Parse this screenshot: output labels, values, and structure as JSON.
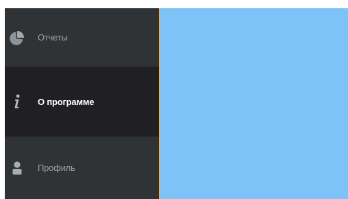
{
  "sidebar": {
    "items": [
      {
        "label": "Отчеты",
        "icon": "pie-chart-icon",
        "active": false
      },
      {
        "label": "О программе",
        "icon": "info-icon",
        "active": true
      },
      {
        "label": "Профиль",
        "icon": "user-icon",
        "active": false
      }
    ]
  },
  "colors": {
    "sidebar_bg": "#303336",
    "active_item_bg": "#1f1f24",
    "accent": "#e2b653",
    "content_bg": "#7ec3f7",
    "inactive_text": "#9aa0a4",
    "active_text": "#ffffff"
  }
}
